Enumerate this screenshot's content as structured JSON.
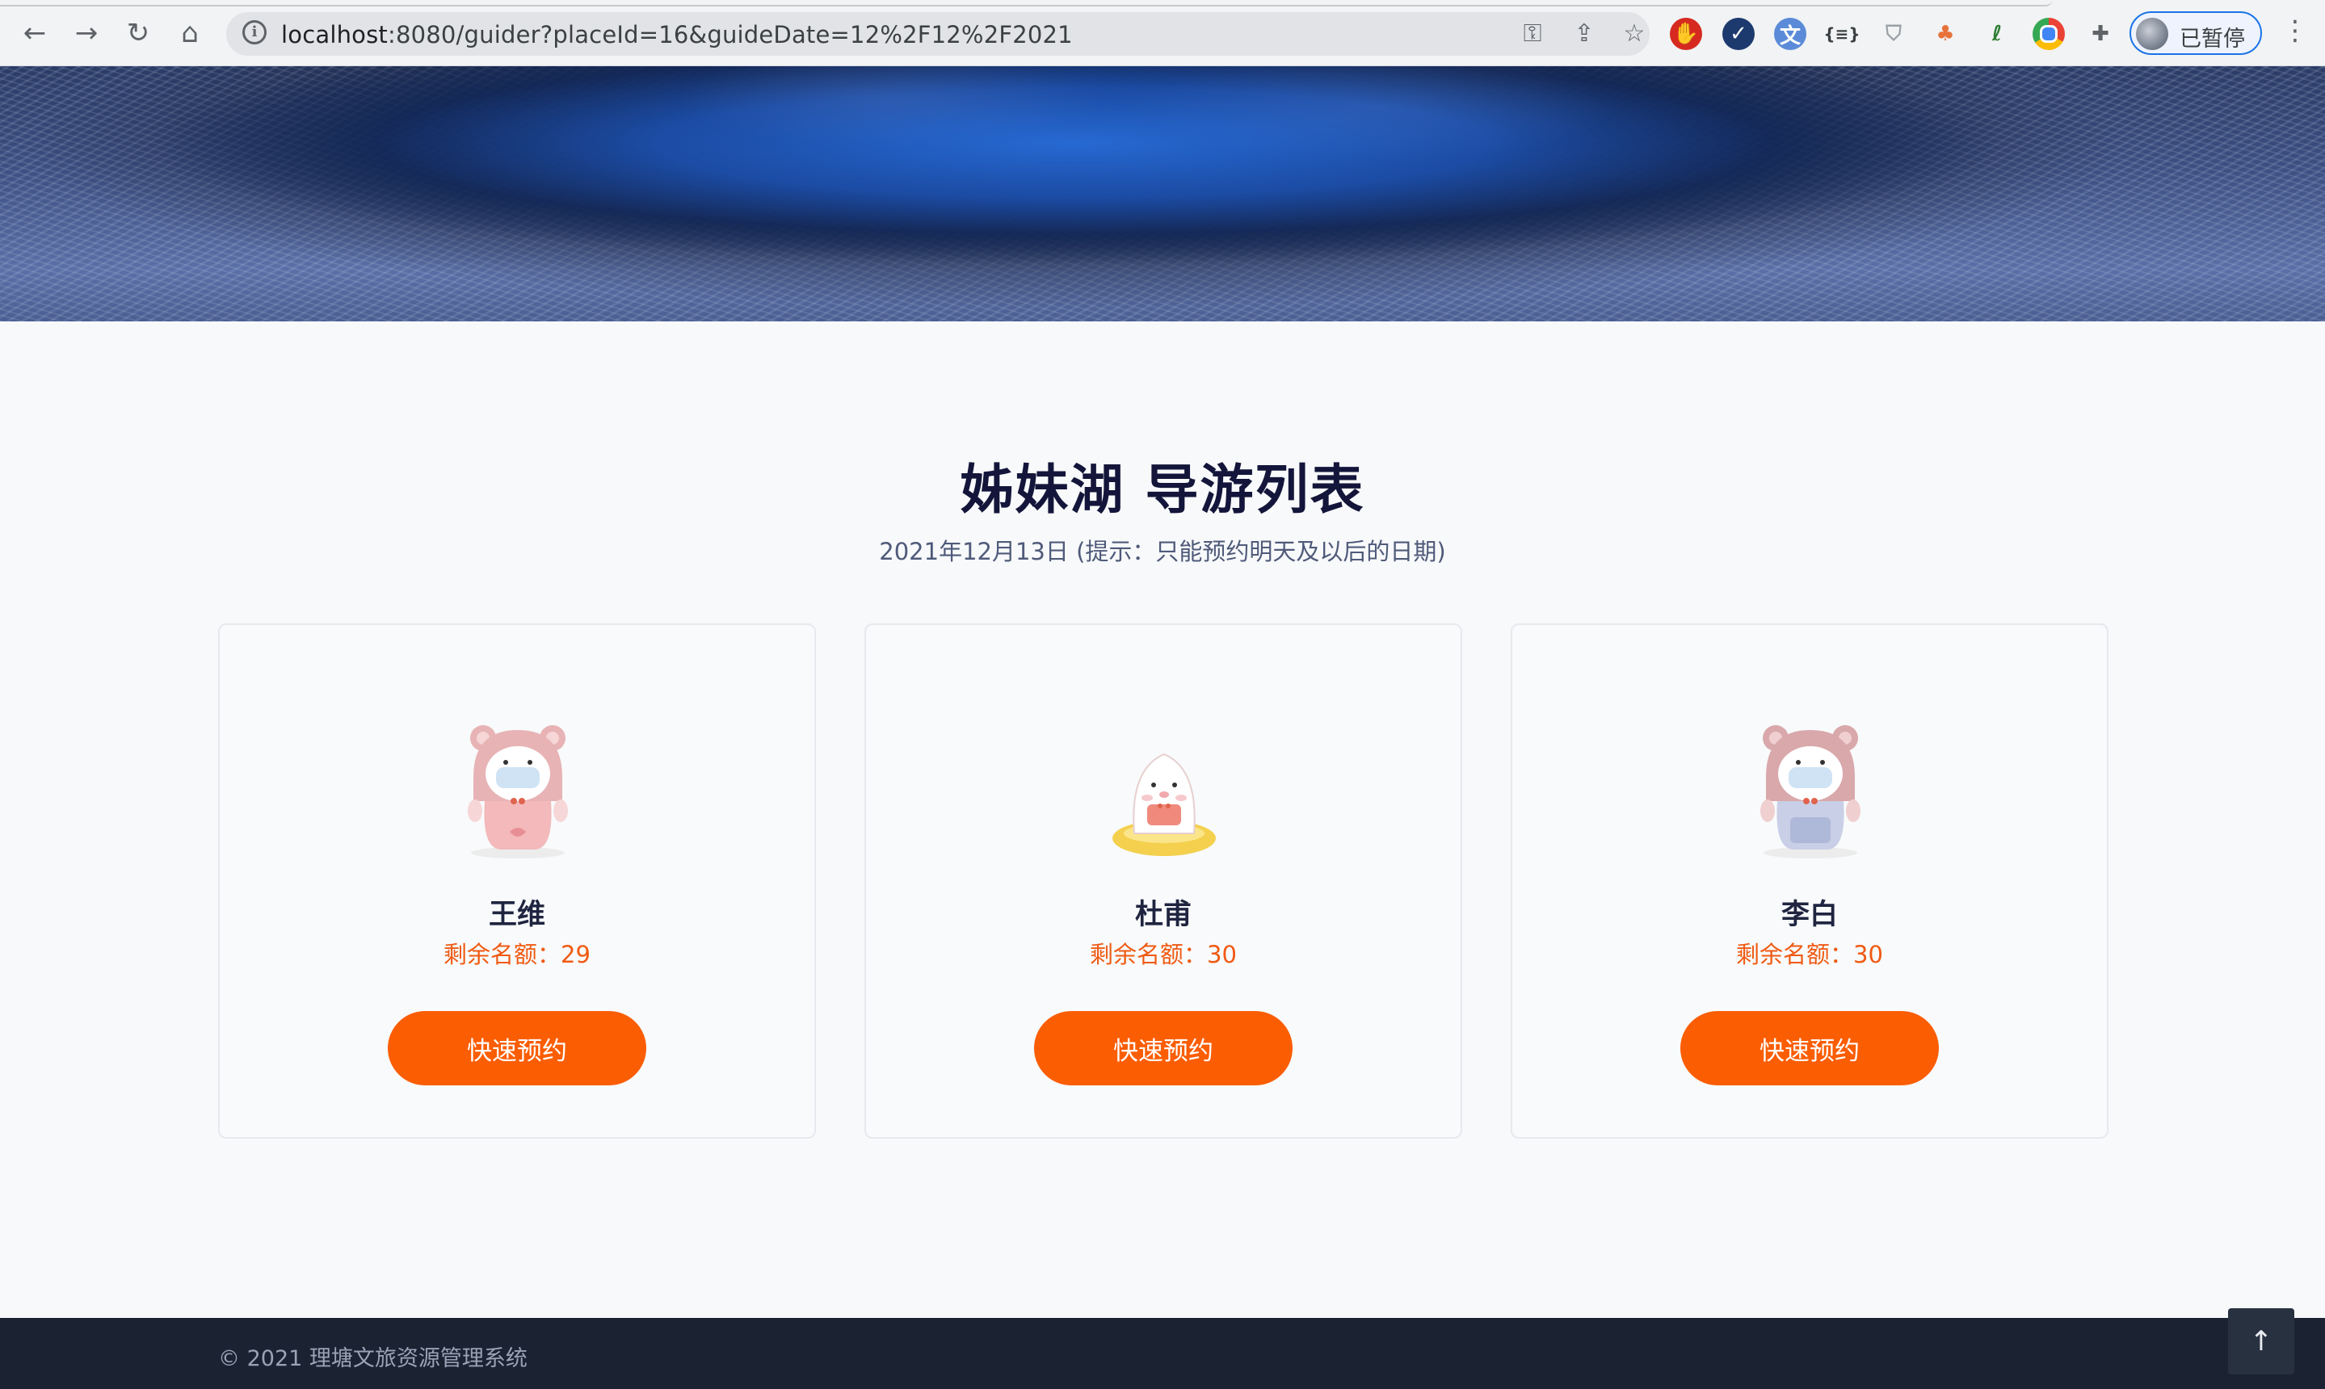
{
  "browser": {
    "url_host": "localhost",
    "url_rest": ":8080/guider?placeId=16&guideDate=12%2F12%2F2021",
    "profile_status": "已暂停",
    "extensions": [
      "adblock-icon",
      "check-icon",
      "translate-icon",
      "json-icon",
      "shield-icon",
      "tree-icon",
      "leaf-icon",
      "chrome-icon",
      "puzzle-icon"
    ]
  },
  "page": {
    "title": "姊妹湖 导游列表",
    "subtitle": "2021年12月13日  (提示：只能预约明天及以后的日期)"
  },
  "guides": [
    {
      "name": "王维",
      "quota_label": "剩余名额：29",
      "button": "快速预约"
    },
    {
      "name": "杜甫",
      "quota_label": "剩余名额：30",
      "button": "快速预约"
    },
    {
      "name": "李白",
      "quota_label": "剩余名额：30",
      "button": "快速预约"
    }
  ],
  "footer": {
    "copyright": "© 2021 理塘文旅资源管理系统"
  },
  "colors": {
    "accent": "#fb5d03",
    "quota_text": "#f05a13",
    "footer_bg": "#1b2232",
    "title": "#13153a"
  }
}
